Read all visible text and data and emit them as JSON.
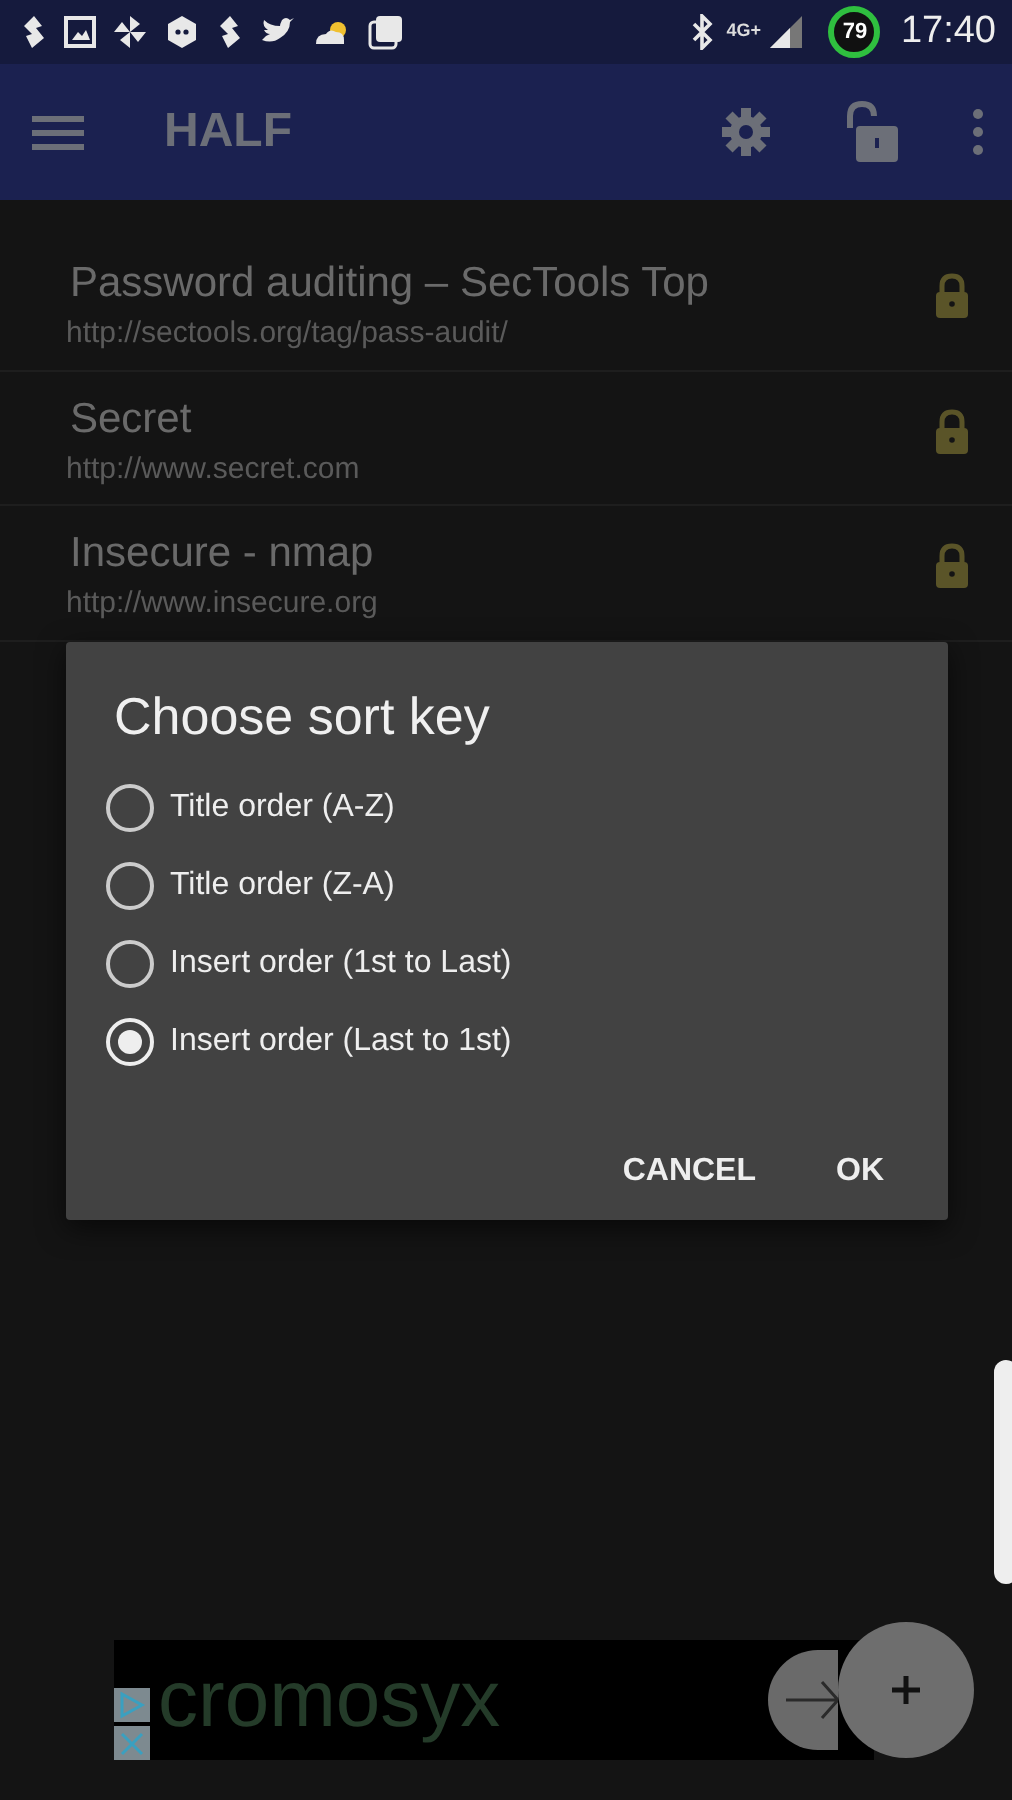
{
  "status_bar": {
    "network": "4G+",
    "battery": "79",
    "time": "17:40"
  },
  "app_bar": {
    "title": "HALF"
  },
  "entries": [
    {
      "title": "Password auditing – SecTools Top",
      "url": "http://sectools.org/tag/pass-audit/",
      "locked": true
    },
    {
      "title": "Secret",
      "url": "http://www.secret.com",
      "locked": true
    },
    {
      "title": "Insecure - nmap",
      "url": "http://www.insecure.org",
      "locked": true
    }
  ],
  "dialog": {
    "title": "Choose sort key",
    "options": [
      {
        "label": "Title order (A-Z)",
        "selected": false
      },
      {
        "label": "Title order (Z-A)",
        "selected": false
      },
      {
        "label": "Insert order (1st to Last)",
        "selected": false
      },
      {
        "label": "Insert order (Last to 1st)",
        "selected": true
      }
    ],
    "buttons": [
      "CANCEL",
      "OK"
    ]
  },
  "ad": {
    "text": "cromosyx"
  }
}
